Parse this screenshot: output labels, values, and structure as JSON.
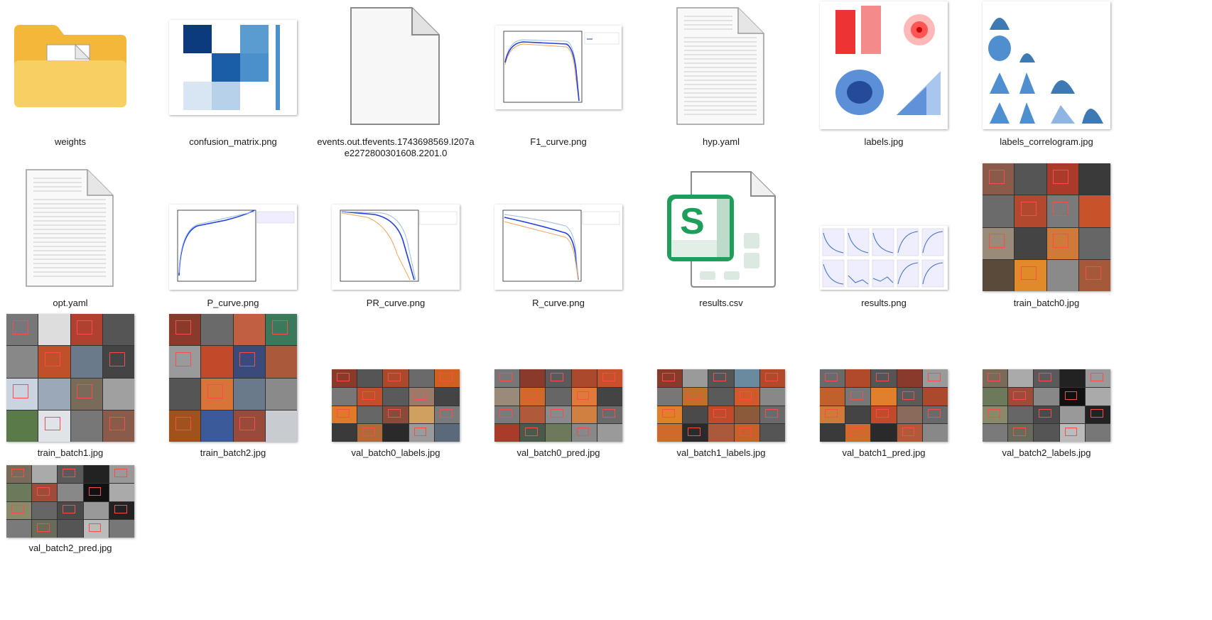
{
  "files": [
    {
      "name": "weights",
      "kind": "folder"
    },
    {
      "name": "confusion_matrix.png",
      "kind": "confusion"
    },
    {
      "name": "events.out.tfevents.1743698569.I207ae2272800301608.2201.0",
      "kind": "blank-file"
    },
    {
      "name": "F1_curve.png",
      "kind": "curve"
    },
    {
      "name": "hyp.yaml",
      "kind": "text-file"
    },
    {
      "name": "labels.jpg",
      "kind": "labels"
    },
    {
      "name": "labels_correlogram.jpg",
      "kind": "correlogram"
    },
    {
      "name": "opt.yaml",
      "kind": "text-file"
    },
    {
      "name": "P_curve.png",
      "kind": "curve"
    },
    {
      "name": "PR_curve.png",
      "kind": "curve"
    },
    {
      "name": "R_curve.png",
      "kind": "curve"
    },
    {
      "name": "results.csv",
      "kind": "spreadsheet"
    },
    {
      "name": "results.png",
      "kind": "results"
    },
    {
      "name": "train_batch0.jpg",
      "kind": "mosaic"
    },
    {
      "name": "train_batch1.jpg",
      "kind": "mosaic"
    },
    {
      "name": "train_batch2.jpg",
      "kind": "mosaic"
    },
    {
      "name": "val_batch0_labels.jpg",
      "kind": "mosaic-wide"
    },
    {
      "name": "val_batch0_pred.jpg",
      "kind": "mosaic-wide"
    },
    {
      "name": "val_batch1_labels.jpg",
      "kind": "mosaic-wide"
    },
    {
      "name": "val_batch1_pred.jpg",
      "kind": "mosaic-wide"
    },
    {
      "name": "val_batch2_labels.jpg",
      "kind": "mosaic-wide"
    },
    {
      "name": "val_batch2_pred.jpg",
      "kind": "mosaic"
    }
  ],
  "icons": {
    "spreadsheet_letter": "S"
  },
  "colors": {
    "folder": "#f6c54a",
    "spreadsheet_green": "#1e9e5a",
    "curve_blue": "#1f3fe0"
  }
}
